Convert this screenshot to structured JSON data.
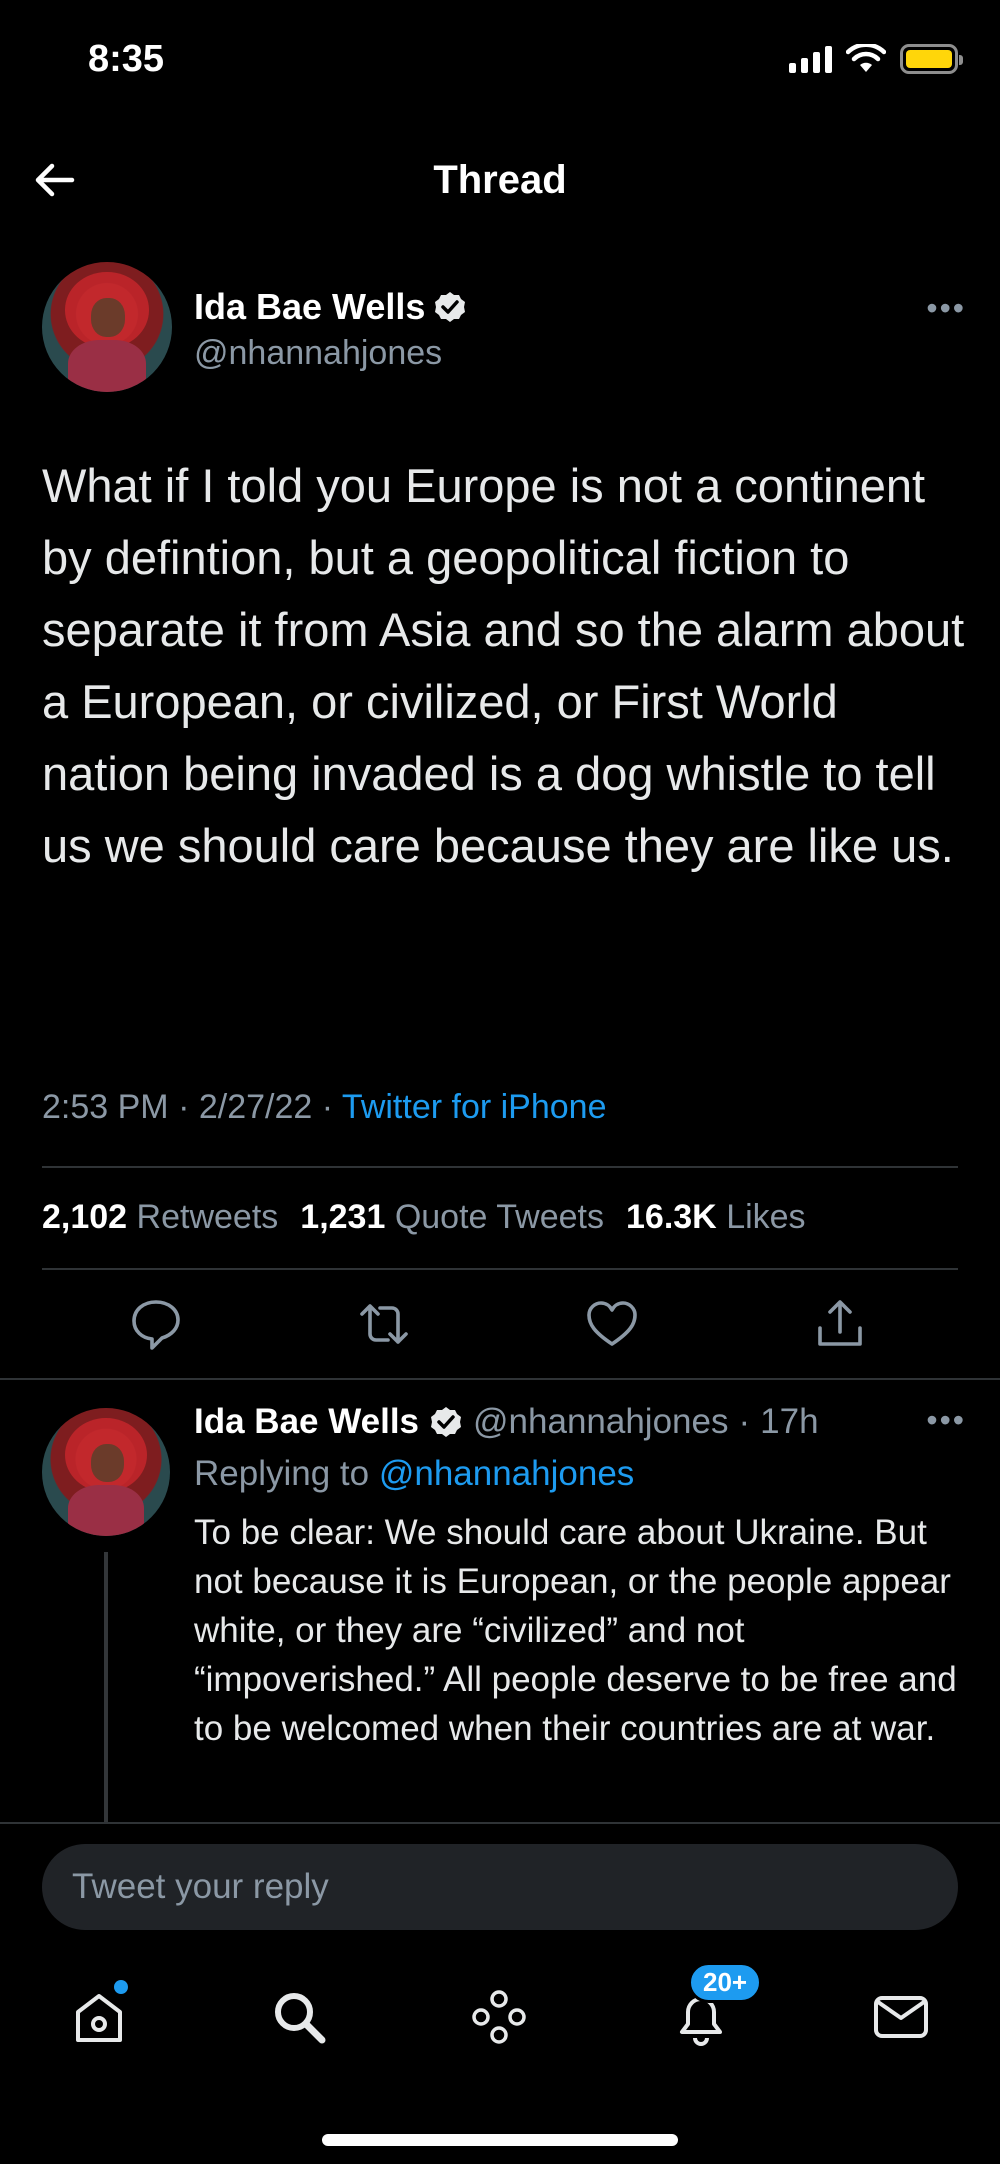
{
  "status_bar": {
    "time": "8:35",
    "battery_color": "#ffd60a",
    "icons": [
      "signal-icon",
      "wifi-icon",
      "battery-icon"
    ]
  },
  "header": {
    "title": "Thread",
    "back_icon": "back-arrow-icon"
  },
  "main_tweet": {
    "author_name": "Ida Bae Wells",
    "handle": "@nhannahjones",
    "verified": true,
    "text": "What if I told you Europe is not a continent by defintion, but a geopolitical fiction to separate it from Asia and so the alarm about a European, or civilized, or First World nation being invaded is a dog whistle to tell us we should care because they are like us.",
    "time": "2:53 PM",
    "date": "2/27/22",
    "source": "Twitter for iPhone",
    "stats": {
      "retweets_count": "2,102",
      "retweets_label": "Retweets",
      "quotes_count": "1,231",
      "quotes_label": "Quote Tweets",
      "likes_count": "16.3K",
      "likes_label": "Likes"
    },
    "actions": [
      "reply-icon",
      "retweet-icon",
      "like-icon",
      "share-icon"
    ]
  },
  "reply_tweet": {
    "author_name": "Ida Bae Wells",
    "handle": "@nhannahjones",
    "age": "17h",
    "replying_prefix": "Replying to",
    "replying_to": "@nhannahjones",
    "text": "To be clear: We should care about Ukraine. But not because it is European, or the people appear white, or they are “civilized” and not “impoverished.” All people deserve to be free and to be welcomed when their countries are at war."
  },
  "composer": {
    "placeholder": "Tweet your reply"
  },
  "tabbar": {
    "items": [
      "home-icon",
      "search-icon",
      "spaces-icon",
      "notifications-icon",
      "messages-icon"
    ],
    "notifications_badge": "20+"
  },
  "colors": {
    "accent": "#1d9bf0",
    "background": "#000000",
    "muted": "#8b98a5"
  }
}
